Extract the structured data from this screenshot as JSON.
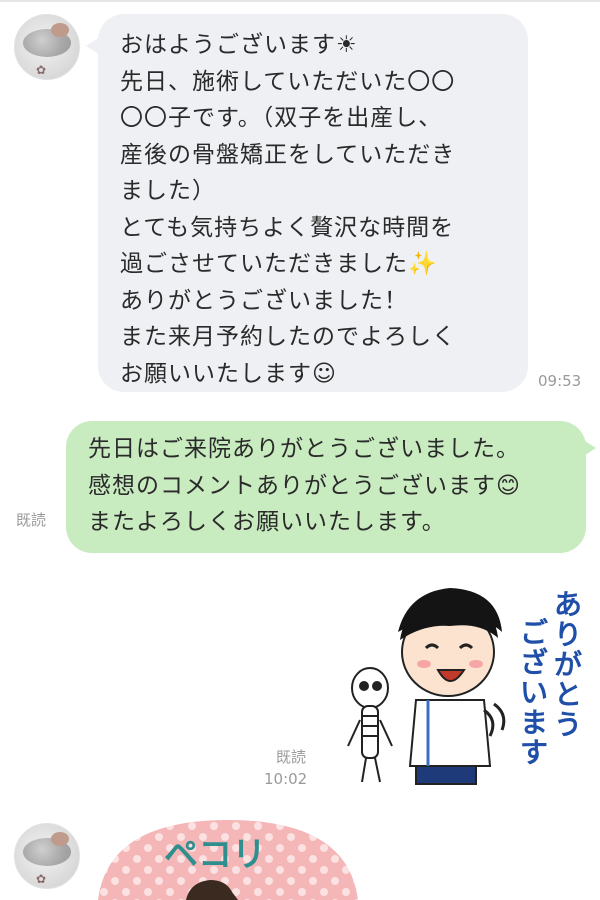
{
  "messages": {
    "first": {
      "text": "おはようございます☀\n先日、施術していただいた〇〇\n〇〇子です。（双子を出産し、\n産後の骨盤矯正をしていただき\nました）\nとても気持ちよく贅沢な時間を\n過ごさせていただきました✨\nありがとうございました！\nまた来月予約したのでよろしく\nお願いいたします☺",
      "time": "09:53"
    },
    "reply": {
      "text": "先日はご来院ありがとうございました。\n感想のコメントありがとうございます😊\nまたよろしくお願いいたします。",
      "read": "既読"
    },
    "sticker": {
      "text": "ありがとう\nございます",
      "read": "既読",
      "time": "10:02"
    },
    "sticker2": {
      "text": "ペコリ"
    }
  },
  "colors": {
    "incoming_bubble": "#eef0f3",
    "outgoing_bubble": "#c9ebc0",
    "meta_text": "#9a9a9a",
    "sticker_text": "#1f4fa8"
  },
  "icons": [
    "contact-avatar-icon",
    "sun-emoji",
    "sparkles-emoji",
    "smile-emoji"
  ]
}
